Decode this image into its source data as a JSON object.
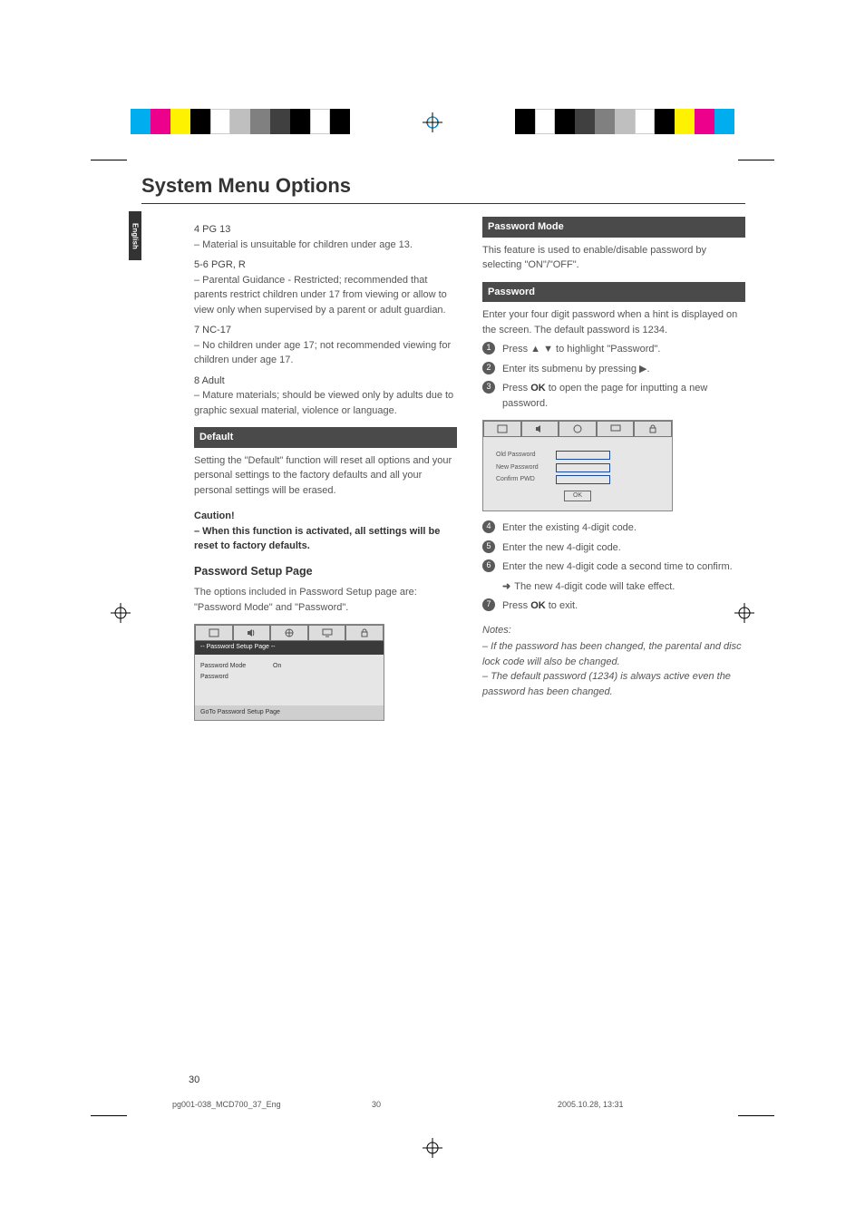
{
  "lang_tab": "English",
  "title": "System Menu Options",
  "left": {
    "ratings": [
      {
        "head": "4 PG 13",
        "body": "–   Material is unsuitable for children under age 13."
      },
      {
        "head": "5-6 PGR, R",
        "body": "–   Parental Guidance - Restricted; recommended that parents restrict children under 17 from viewing or allow to view only when supervised by a parent or adult guardian."
      },
      {
        "head": "7 NC-17",
        "body": "–   No children under age 17; not recommended viewing for children under age 17."
      },
      {
        "head": "8 Adult",
        "body": "–   Mature materials; should be viewed only by adults due to graphic sexual material, violence or language."
      }
    ],
    "default_bar": "Default",
    "default_body": "Setting the \"Default\" function will reset all options and your personal settings to the factory defaults and all your personal settings will be erased.",
    "caution_head": "Caution!",
    "caution_body": "–   When this function is activated, all settings will be reset to factory defaults.",
    "pwd_setup_head": "Password Setup Page",
    "pwd_setup_body": "The options included in Password Setup page are: \"Password Mode\" and \"Password\".",
    "screenshot1": {
      "header": "-- Password Setup Page --",
      "rows": [
        {
          "label": "Password Mode",
          "value": "On"
        },
        {
          "label": "Password",
          "value": ""
        }
      ],
      "footer": "GoTo Password Setup Page"
    }
  },
  "right": {
    "pwd_mode_bar": "Password Mode",
    "pwd_mode_body": "This feature is used to enable/disable password by selecting \"ON\"/\"OFF\".",
    "pwd_bar": "Password",
    "pwd_body": "Enter your four digit password when a hint is displayed on the screen. The default password is 1234.",
    "steps1": [
      "Press ▲ ▼ to highlight \"Password\".",
      "Enter its submenu by pressing ▶.",
      "Press OK to open the page for inputting a new password."
    ],
    "screenshot2": {
      "rows": [
        "Old Password",
        "New Password",
        "Confirm PWD"
      ],
      "ok": "OK"
    },
    "steps2": [
      "Enter the existing 4-digit code.",
      "Enter the new 4-digit code.",
      "Enter the new 4-digit code a second time to confirm."
    ],
    "step6_sub": "The new 4-digit code will take effect.",
    "step7": "Press OK to exit.",
    "notes_head": "Notes:",
    "notes": [
      "–   If the password has been changed, the parental and disc lock code will also be changed.",
      "–   The default password (1234) is always active even the password has been changed."
    ]
  },
  "page_number": "30",
  "footer": {
    "left": "pg001-038_MCD700_37_Eng",
    "mid": "30",
    "right": "2005.10.28, 13:31"
  }
}
